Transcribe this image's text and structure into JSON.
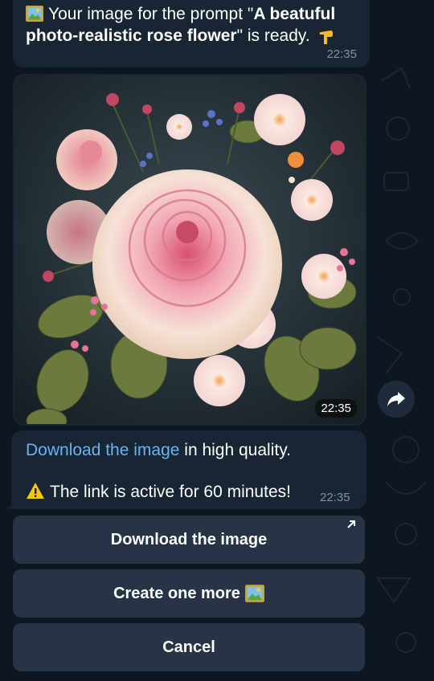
{
  "message_prompt": {
    "prefix": "Your image for the prompt \"",
    "prompt_bold": "A beatuful photo-realistic rose flower",
    "suffix": "\" is ready.",
    "time": "22:35"
  },
  "photo": {
    "time": "22:35",
    "description_icon": "rose-bouquet-image"
  },
  "message_link": {
    "link_text": "Download the image",
    "after_link": " in high quality.",
    "warning": "The link is active for 60 minutes!",
    "time": "22:35"
  },
  "keyboard": {
    "buttons": [
      {
        "label": "Download the image"
      },
      {
        "label": "Create one more"
      },
      {
        "label": "Cancel"
      }
    ]
  },
  "colors": {
    "bg": "#0e1621",
    "bubble": "#182533",
    "link": "#6ab3f3",
    "button": "#2a3a4b"
  }
}
